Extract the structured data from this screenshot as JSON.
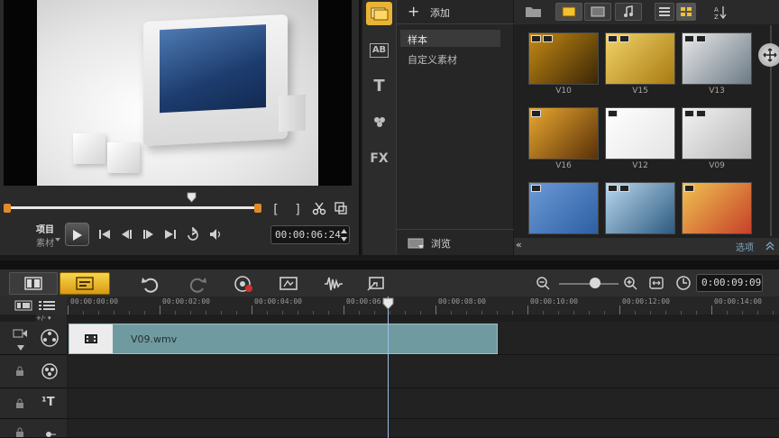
{
  "preview": {
    "mode_project": "项目",
    "mode_clip": "素材",
    "timecode": "00:00:06:24",
    "trim_in_label": "[",
    "trim_out_label": "]"
  },
  "library": {
    "add_label": "添加",
    "folders": [
      "样本",
      "自定义素材"
    ],
    "browse_label": "浏览",
    "options_label": "选项",
    "side_icons": [
      "media-icon",
      "transition-icon",
      "title-icon",
      "graphic-icon",
      "filter-icon"
    ],
    "thumbs": [
      {
        "label": "V10",
        "c1": "#c58a14",
        "c2": "#3a2606"
      },
      {
        "label": "V15",
        "c1": "#f1d46a",
        "c2": "#a87a10"
      },
      {
        "label": "V13",
        "c1": "#e9e9e9",
        "c2": "#6b7a86"
      },
      {
        "label": "V16",
        "c1": "#e9a830",
        "c2": "#5a3008"
      },
      {
        "label": "V12",
        "c1": "#ffffff",
        "c2": "#e4e4e4"
      },
      {
        "label": "V09",
        "c1": "#f2f2f2",
        "c2": "#b8b8b8"
      },
      {
        "label": "",
        "c1": "#6d9ad6",
        "c2": "#2c5fa3"
      },
      {
        "label": "",
        "c1": "#b9d8ee",
        "c2": "#2d5a80"
      },
      {
        "label": "",
        "c1": "#f0c250",
        "c2": "#c7402a"
      }
    ]
  },
  "timeline": {
    "total_time": "0:00:09:09",
    "ticks": [
      "00:00:00:00",
      "00:00:02:00",
      "00:00:04:00",
      "00:00:06:00",
      "00:00:08:00",
      "00:00:10:00",
      "00:00:12:00",
      "00:00:14:00"
    ],
    "clip_name": "V09.wmv"
  },
  "colors": {
    "accent": "#e08a2a",
    "clip": "#6f9aa0",
    "storyboard_active": "#f2c230"
  }
}
